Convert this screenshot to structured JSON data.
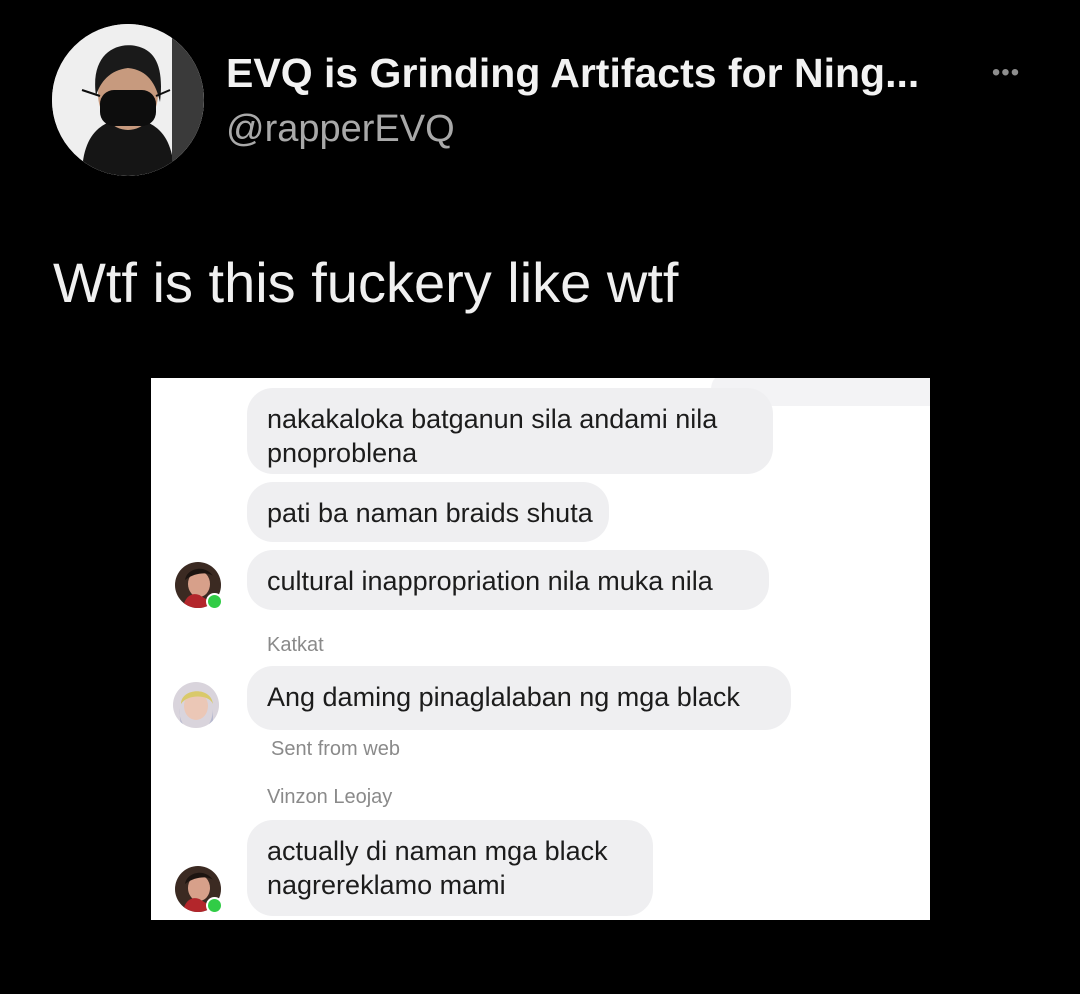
{
  "tweet": {
    "display_name": "EVQ is Grinding Artifacts for Ning...",
    "handle": "@rapperEVQ",
    "more_icon": "more-horizontal-icon",
    "text": "Wtf is this fuckery like wtf"
  },
  "chat": {
    "bubbles": [
      "nakakaloka batganun sila andami nila\npnoproblena",
      "pati ba naman braids shuta",
      "cultural inappropriation nila muka nila",
      "Ang daming pinaglalaban ng mga black",
      "actually di naman mga black\nnagrereklamo mami"
    ],
    "senders": [
      "Katkat",
      "Vinzon Leojay"
    ],
    "sent_from": "Sent from web",
    "online_color": "#31cc46"
  }
}
